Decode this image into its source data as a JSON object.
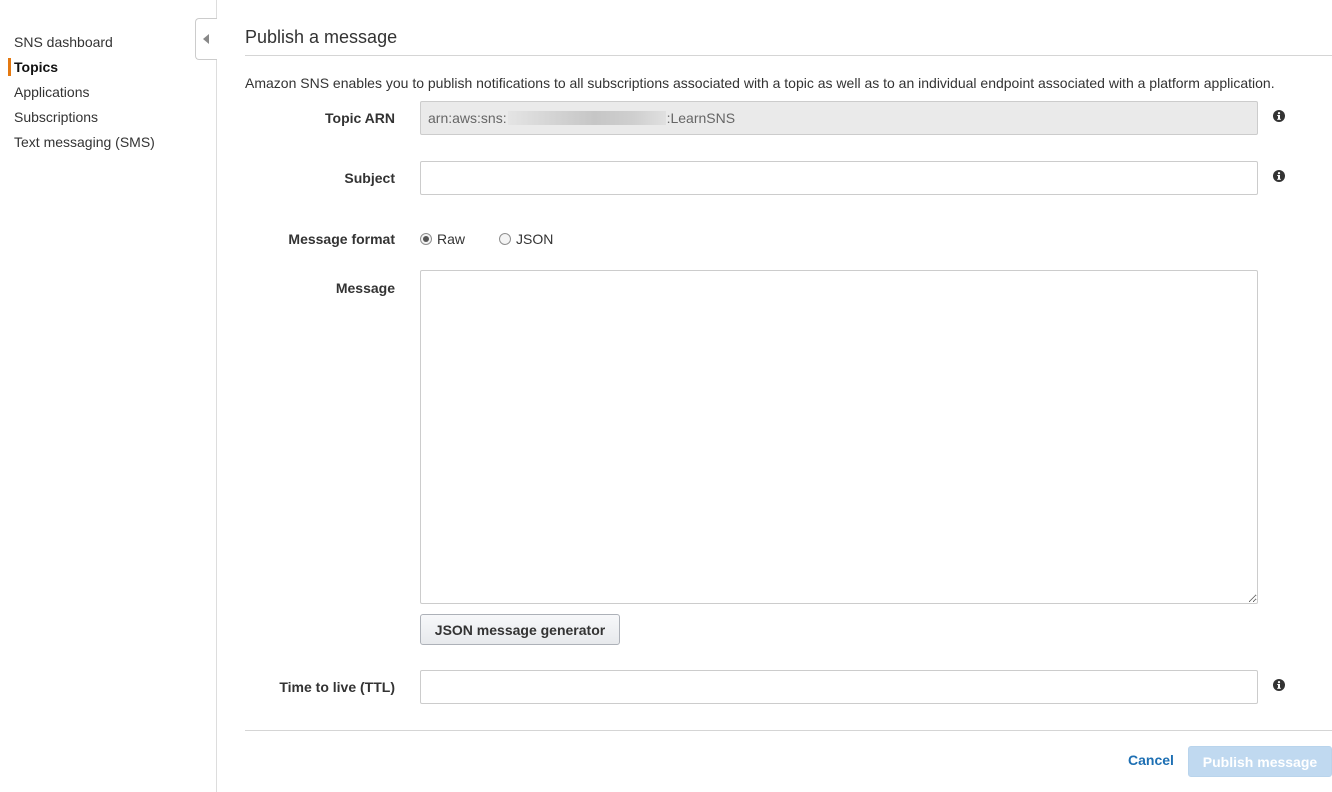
{
  "sidebar": {
    "items": [
      {
        "label": "SNS dashboard",
        "active": false
      },
      {
        "label": "Topics",
        "active": true
      },
      {
        "label": "Applications",
        "active": false
      },
      {
        "label": "Subscriptions",
        "active": false
      },
      {
        "label": "Text messaging (SMS)",
        "active": false
      }
    ],
    "collapse_icon": "caret-left-icon"
  },
  "main": {
    "title": "Publish a message",
    "description": "Amazon SNS enables you to publish notifications to all subscriptions associated with a topic as well as to an individual endpoint associated with a platform application.",
    "topic_arn": {
      "label": "Topic ARN",
      "value_prefix": "arn:aws:sns:",
      "value_suffix": ":LearnSNS",
      "info_icon": "info-icon"
    },
    "subject": {
      "label": "Subject",
      "value": "",
      "info_icon": "info-icon"
    },
    "message_format": {
      "label": "Message format",
      "options": [
        {
          "label": "Raw",
          "selected": true
        },
        {
          "label": "JSON",
          "selected": false
        }
      ]
    },
    "message": {
      "label": "Message",
      "value": ""
    },
    "json_generator_label": "JSON message generator",
    "ttl": {
      "label": "Time to live (TTL)",
      "value": "",
      "info_icon": "info-icon"
    }
  },
  "footer": {
    "cancel_label": "Cancel",
    "publish_label": "Publish message"
  },
  "colors": {
    "accent": "#e47911",
    "link": "#1d6fb3",
    "publish_disabled": "#c0d9f0"
  }
}
